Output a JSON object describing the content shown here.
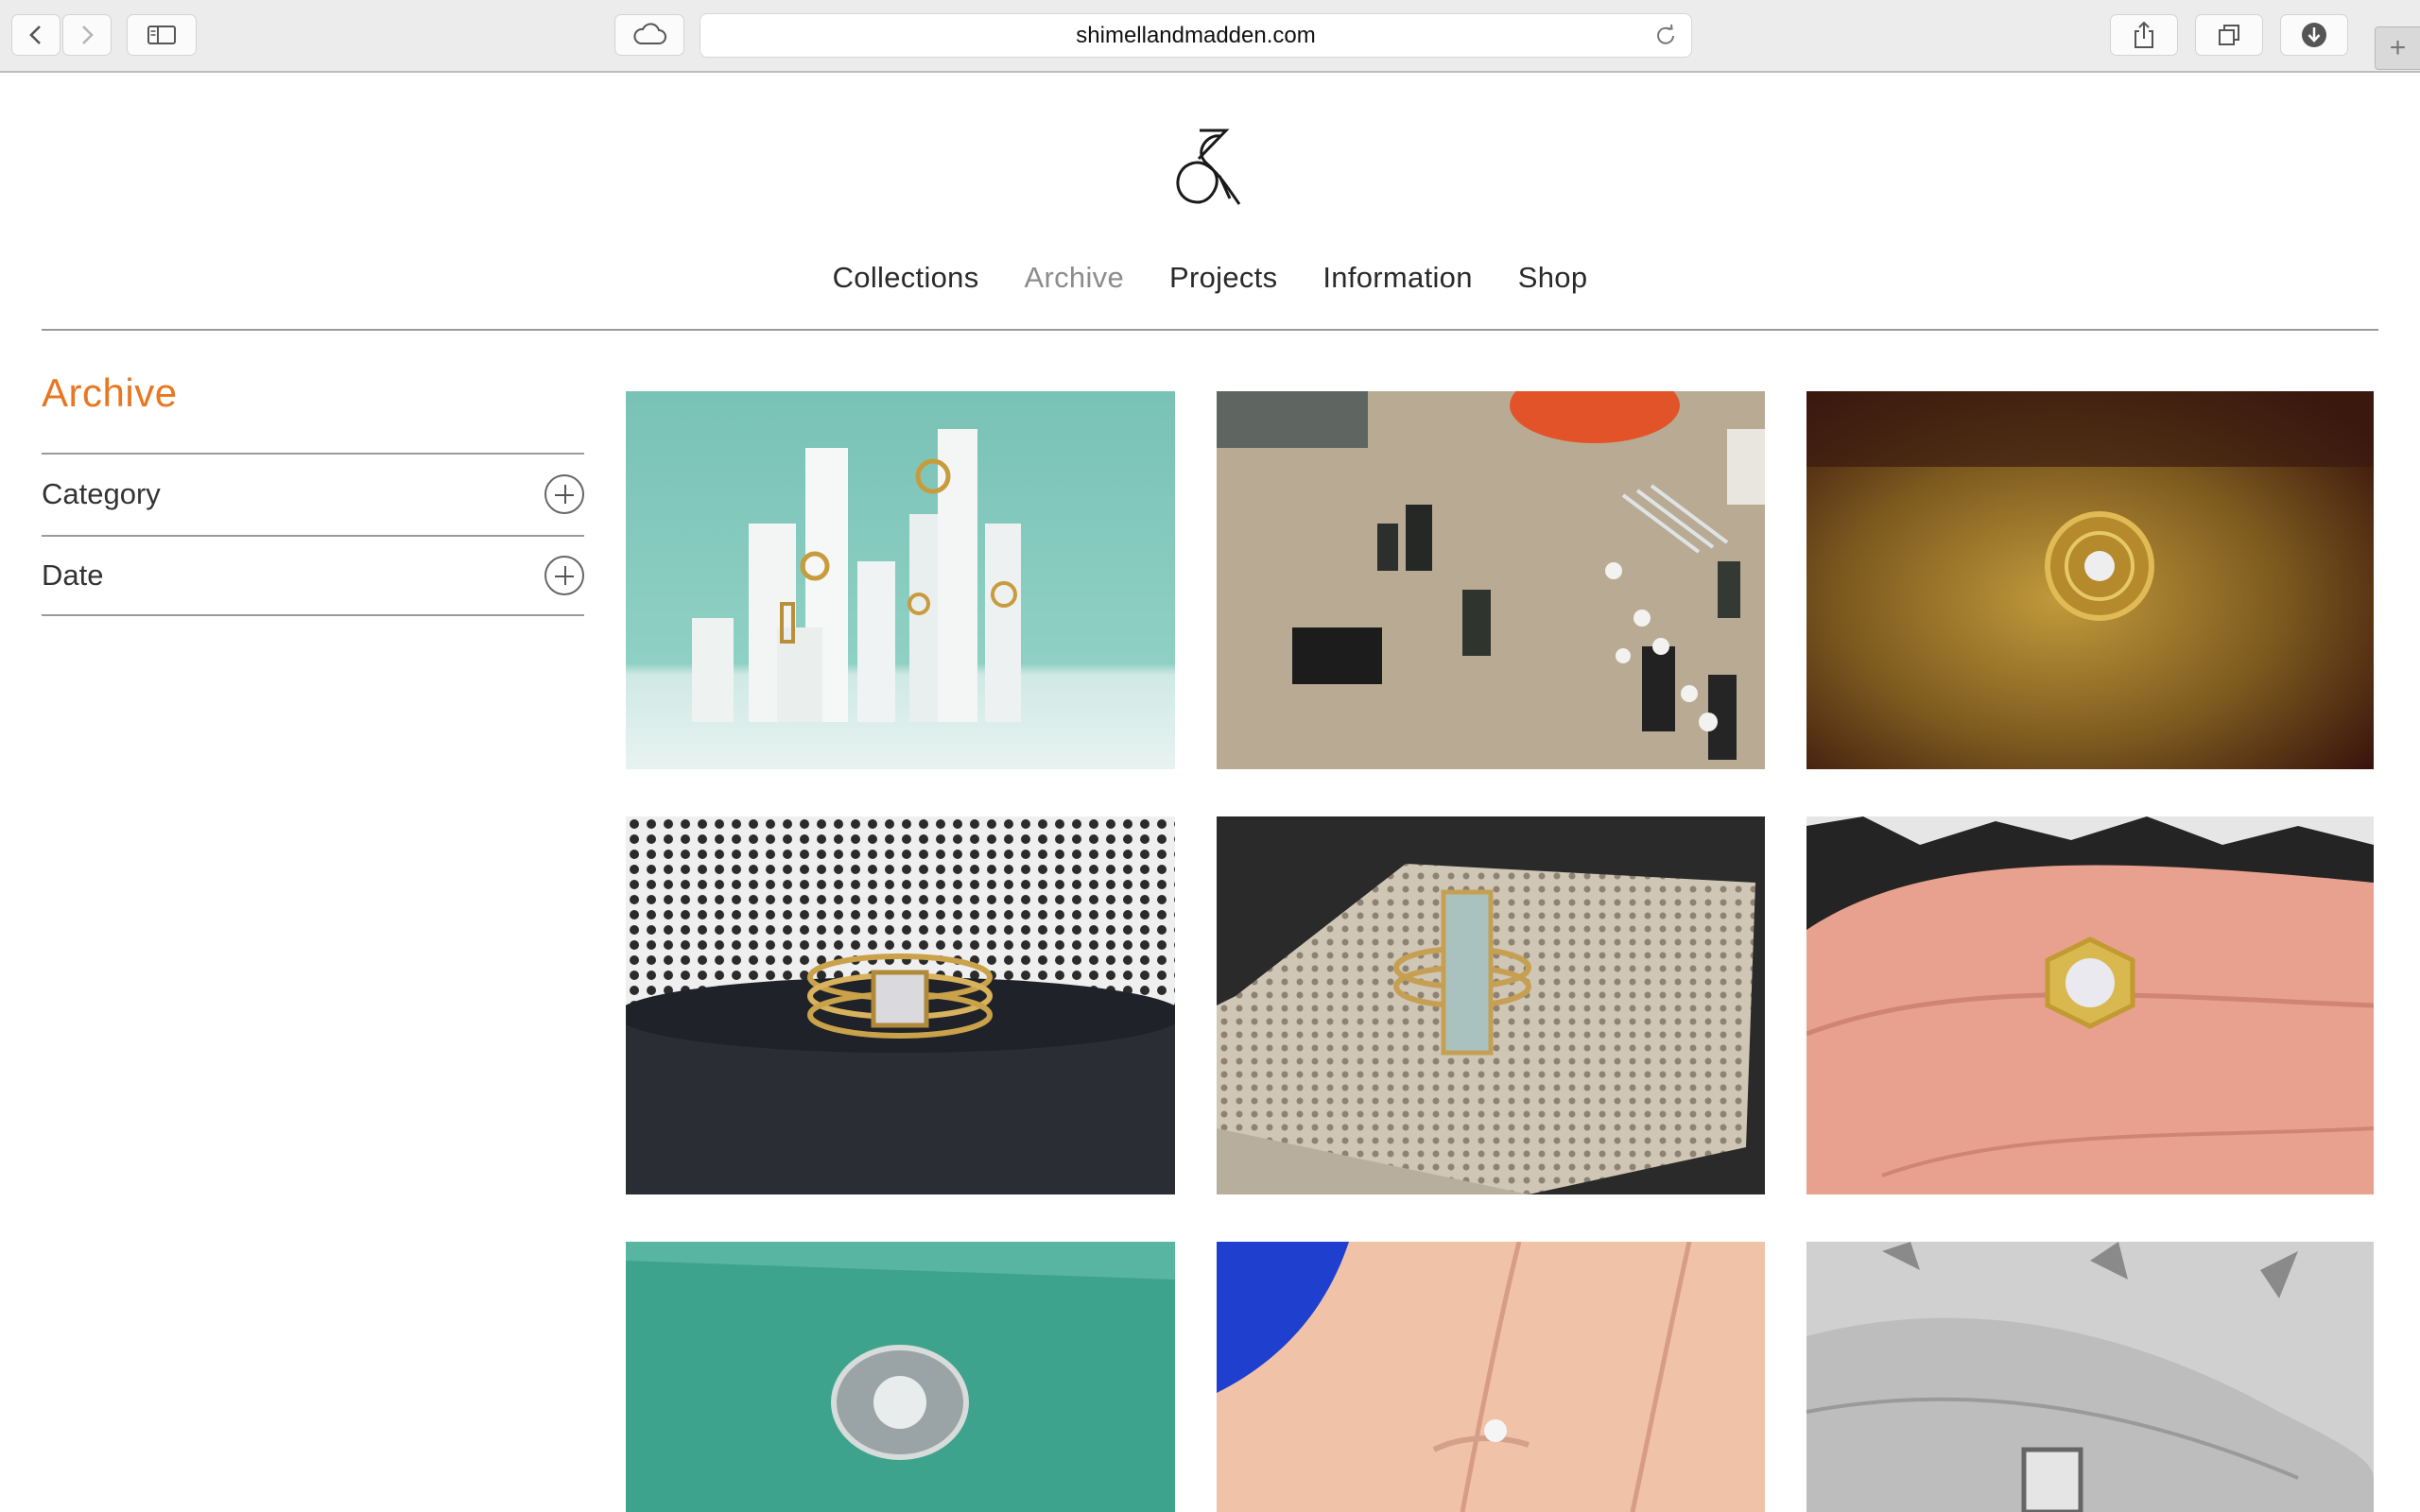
{
  "browser": {
    "url": "shimellandmadden.com",
    "new_tab_label": "+"
  },
  "site": {
    "logo_alt": "Shimell and Madden ampersand logo",
    "nav": [
      {
        "label": "Collections"
      },
      {
        "label": "Archive"
      },
      {
        "label": "Projects"
      },
      {
        "label": "Information"
      },
      {
        "label": "Shop"
      }
    ],
    "active_nav": "Archive",
    "accent_color": "#e87722"
  },
  "sidebar": {
    "title": "Archive",
    "filters": [
      {
        "label": "Category"
      },
      {
        "label": "Date"
      }
    ]
  },
  "grid": {
    "images": [
      {
        "subject": "gold rings on selenite crystal pillars, mint background"
      },
      {
        "subject": "workbench with ring components, tubes and white beads"
      },
      {
        "subject": "gold maze ring with diamond on dark gold-leaf surface"
      },
      {
        "subject": "gold triple band ring with square diamond on black slate"
      },
      {
        "subject": "aquamarine bar ring on honeycomb soldering block"
      },
      {
        "subject": "gold hexagonal diamond ring worn on hand"
      },
      {
        "subject": "ornate vintage diamond ring on teal background"
      },
      {
        "subject": "rose gold solitaire ring worn on finger, blue sleeve"
      },
      {
        "subject": "black and white photo of ring on hand"
      }
    ]
  }
}
